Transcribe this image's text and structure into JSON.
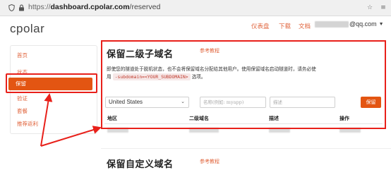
{
  "browser": {
    "url_scheme": "https://",
    "url_host": "dashboard.cpolar.com",
    "url_path": "/reserved"
  },
  "header": {
    "logo": "cpolar",
    "nav": [
      "仪表盘",
      "下载",
      "文档"
    ],
    "user_suffix": "@qq.com"
  },
  "sidebar": {
    "items": [
      "首页",
      "状态",
      "保留",
      "验证",
      "套餐",
      "推荐返利"
    ],
    "active_index": 2
  },
  "main": {
    "title": "保留二级子域名",
    "ref_note": "参考教程",
    "description_1": "即使您的隧道处于脱机状态，也不会将保留域名分配给其他用户。使用保留域名启动隧道时，请务必使用",
    "code": "-subdomain=<YOUR_SUBDOMAIN>",
    "description_2": "选项。",
    "region_selected": "United States",
    "name_placeholder": "名称(例如: myapp)",
    "desc_placeholder": "描述",
    "reserve_button": "保留",
    "columns": [
      "地区",
      "二级域名",
      "描述",
      "操作"
    ]
  },
  "section2": {
    "title": "保留自定义域名",
    "ref_note": "参考教程"
  },
  "colors": {
    "accent": "#e35512",
    "annotation": "#e8201a",
    "link": "#e0643c"
  }
}
